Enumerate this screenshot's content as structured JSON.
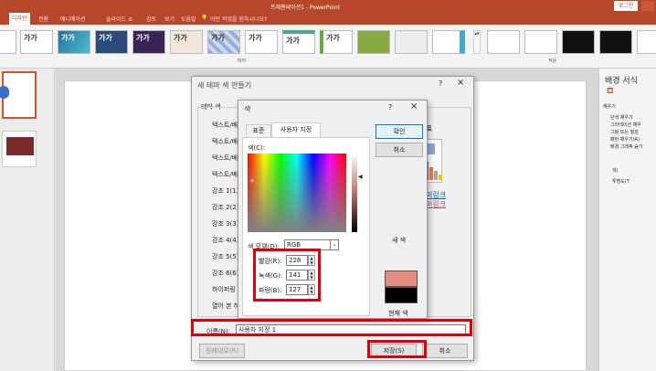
{
  "window": {
    "title": "프레젠테이션1 - PowerPoint",
    "signin": "로그인"
  },
  "ribbon": {
    "tabs": [
      "디자인",
      "전환",
      "애니메이션",
      "슬라이드 쇼",
      "검토",
      "보기",
      "도움말"
    ],
    "tell_me": "어떤 작업을 원하시나요?",
    "themes": [
      "가가",
      "가가",
      "가가",
      "가가",
      "가가",
      "가가",
      "가가",
      "가가",
      "가가"
    ],
    "group_theme": "테마",
    "group_variant": "적용"
  },
  "right_pane": {
    "title": "배경 서식",
    "section": "채우기",
    "options": [
      "단색 채우기",
      "그라데이션 채우",
      "그림 또는 질감",
      "패턴 채우기(A)",
      "배경 그래픽 숨기"
    ],
    "color_label": "색(",
    "transparency_label": "투명도(T"
  },
  "theme_dialog": {
    "title": "새 테마 색 만들기",
    "help": "?",
    "close": "×",
    "group_label": "테마 색",
    "rows": [
      "텍스트/배",
      "텍스트/배",
      "텍스트/배",
      "텍스트/배",
      "강조 1(1)",
      "강조 2(2)",
      "강조 3(3)",
      "강조 4(4)",
      "강조 5(5)",
      "강조 6(6)",
      "하이퍼링",
      "열어 본 하"
    ],
    "sample_text": "스트",
    "hyperlink1": "퍼링크",
    "hyperlink2": "퍼링크",
    "name_label": "이름(N):",
    "name_value": "사용자 지정 1",
    "reset": "원래대로(R)",
    "save": "저장(S)",
    "cancel": "취소"
  },
  "color_dialog": {
    "title": "색",
    "help": "?",
    "close": "×",
    "tabs": [
      "표준",
      "사용자 지정"
    ],
    "colors_label": "색(C):",
    "model_label": "색 모델(D):",
    "model_value": "RGB",
    "red_label": "빨강(R):",
    "red_value": "228",
    "green_label": "녹색(G):",
    "green_value": "141",
    "blue_label": "파랑(B):",
    "blue_value": "127",
    "ok": "확인",
    "cancel": "취소",
    "new_label": "새 색",
    "current_label": "현재 색",
    "new_color": "#e48d7f",
    "current_color": "#000000"
  }
}
